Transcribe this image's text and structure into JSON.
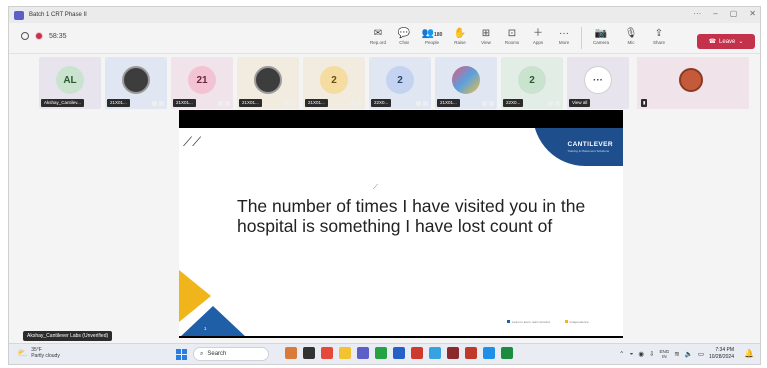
{
  "window": {
    "title": "Batch 1 CRT Phase II",
    "controls": [
      "···",
      "–",
      "▢",
      "✕"
    ]
  },
  "meeting": {
    "timer": "58:35"
  },
  "toolbar": {
    "tools": [
      {
        "name": "record",
        "icon": "✉",
        "label": "Rep.ord"
      },
      {
        "name": "chat",
        "icon": "💬",
        "label": "Chat"
      },
      {
        "name": "people",
        "icon": "👥",
        "label": "People",
        "count": "180"
      },
      {
        "name": "raise",
        "icon": "✋",
        "label": "Raise"
      },
      {
        "name": "view",
        "icon": "⊞",
        "label": "View"
      },
      {
        "name": "rooms",
        "icon": "⊡",
        "label": "Rooms"
      },
      {
        "name": "apps",
        "icon": "＋",
        "label": "Apps"
      },
      {
        "name": "more",
        "icon": "···",
        "label": "More"
      }
    ],
    "media": [
      {
        "name": "camera",
        "icon": "📷",
        "label": "Camera"
      },
      {
        "name": "mic",
        "icon": "🎙",
        "label": "Mic"
      },
      {
        "name": "share",
        "icon": "⇪",
        "label": "Share"
      }
    ],
    "leave_label": "Leave"
  },
  "participants": [
    {
      "initials": "AL",
      "style": "av-green",
      "bg": "",
      "tag": "Akshay_Cantilev..."
    },
    {
      "initials": "",
      "style": "av-photo",
      "bg": "blue",
      "tag": "21X01..."
    },
    {
      "initials": "21",
      "style": "av-pink",
      "bg": "pink",
      "tag": "21X01..."
    },
    {
      "initials": "",
      "style": "av-photo",
      "bg": "yellow",
      "tag": "21X01..."
    },
    {
      "initials": "2",
      "style": "av-yellow",
      "bg": "yellow",
      "tag": "21X01..."
    },
    {
      "initials": "2",
      "style": "av-blue",
      "bg": "blue",
      "tag": "22X0..."
    },
    {
      "initials": "",
      "style": "av-colorful",
      "bg": "blue",
      "tag": "21X01..."
    },
    {
      "initials": "2",
      "style": "av-green",
      "bg": "green",
      "tag": "22X0..."
    },
    {
      "initials": "···",
      "style": "av-more",
      "bg": "",
      "tag": "View all"
    }
  ],
  "slide": {
    "brand": "CANTILEVER",
    "brand_sub": "Training & Placement Solutions",
    "text": "The number of times I have visited you in the hospital is something I have lost count of",
    "page": "1",
    "legend": [
      "Learn to learn. learn forward.",
      "Independence"
    ]
  },
  "presenter_label": "Akshay_Cantilever Labs (Unverified)",
  "taskbar": {
    "weather_temp": "35°F",
    "weather_desc": "Partly cloudy",
    "search_placeholder": "Search",
    "lang": "ENG",
    "lang_region": "IN",
    "time": "7:34 PM",
    "date": "10/28/2024"
  },
  "colors": {
    "accent": "#5b5fc7",
    "leave": "#c4314b",
    "brand_blue": "#1e4f8c",
    "slide_yellow": "#f1b51c"
  }
}
